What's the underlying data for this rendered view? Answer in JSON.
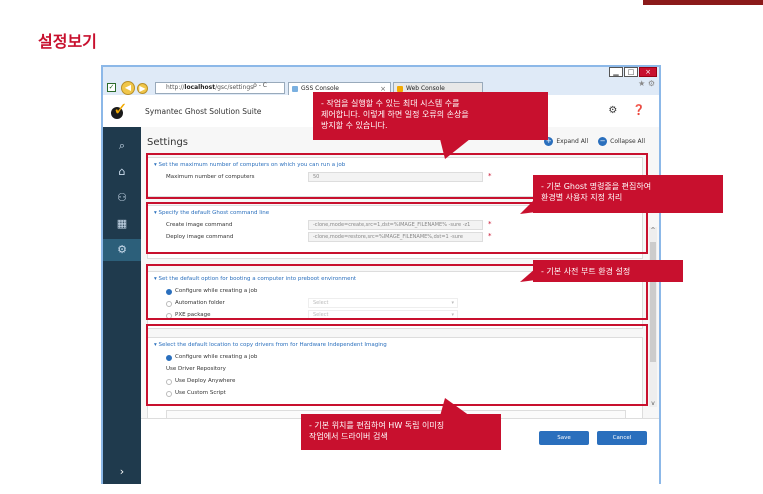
{
  "page": {
    "title": "설정보기"
  },
  "browser": {
    "url_prefix": "http://",
    "url_host": "localhost",
    "url_path": "/gsc/settings",
    "addr_tools": "ρ - C",
    "tabs": [
      {
        "label": "GSS Console",
        "close": "×"
      },
      {
        "label": "Web Console"
      }
    ],
    "window_controls": {
      "minimize": "▁",
      "maximize": "□",
      "close": "×"
    },
    "tool_icons": "★ ⚙"
  },
  "app": {
    "name": "Symantec Ghost Solution Suite",
    "header_icons": "⚙ ❓",
    "settings_title": "Settings",
    "expand_all": "Expand All",
    "collapse_all": "Collapse All",
    "sidebar": [
      {
        "icon": "search-icon",
        "glyph": "⌕"
      },
      {
        "icon": "home-icon",
        "glyph": "⌂"
      },
      {
        "icon": "puzzle-icon",
        "glyph": "⚇"
      },
      {
        "icon": "report-icon",
        "glyph": "▦"
      },
      {
        "icon": "settings-icon",
        "glyph": "⚙"
      }
    ],
    "expand_glyph": "›"
  },
  "panels": {
    "max_computers": {
      "header": "▾  Set the maximum number of computers on which you can run a job",
      "label": "Maximum number of computers",
      "value": "50",
      "req": "*"
    },
    "ghost_cmd": {
      "header": "▾  Specify the default Ghost command line",
      "create_label": "Create image command",
      "create_value": "-clone,mode=create,src=1,dst=%IMAGE_FILENAME% -sure -z1",
      "deploy_label": "Deploy image command",
      "deploy_value": "-clone,mode=restore,src=%IMAGE_FILENAME%,dst=1 -sure",
      "req": "*"
    },
    "preboot": {
      "header": "▾  Set the default option for booting a computer into preboot environment",
      "opt1": "Configure while creating a job",
      "opt2": "Automation folder",
      "opt3": "PXE package",
      "select_placeholder": "Select"
    },
    "drivers": {
      "header": "▾  Select the default location to copy drivers from for Hardware Independent Imaging",
      "opt1": "Configure while creating a job",
      "opt2": "Use Driver Repository",
      "opt3": "Use Deploy Anywhere",
      "opt4": "Use Custom Script"
    }
  },
  "footer": {
    "save": "Save",
    "cancel": "Cancel"
  },
  "callouts": {
    "top": "- 작업을 실행할 수 있는 최대 시스템 수를\n  제어합니다. 이렇게 하면 일정 오류의 손상을\n  방지할 수 있습니다.",
    "ghost": "- 기본 Ghost 명령줄을 편집하여\n  환경별 사용자 지정 처리",
    "boot": "- 기본 사전 부트 환경 설정",
    "driver": "- 기본 위치를 편집하여 HW 독립 이미징\n  작업에서 드라이버 검색"
  },
  "colors": {
    "accent_red": "#c8102e",
    "sidebar": "#1f3a4d",
    "primary_blue": "#2a6fbd"
  }
}
